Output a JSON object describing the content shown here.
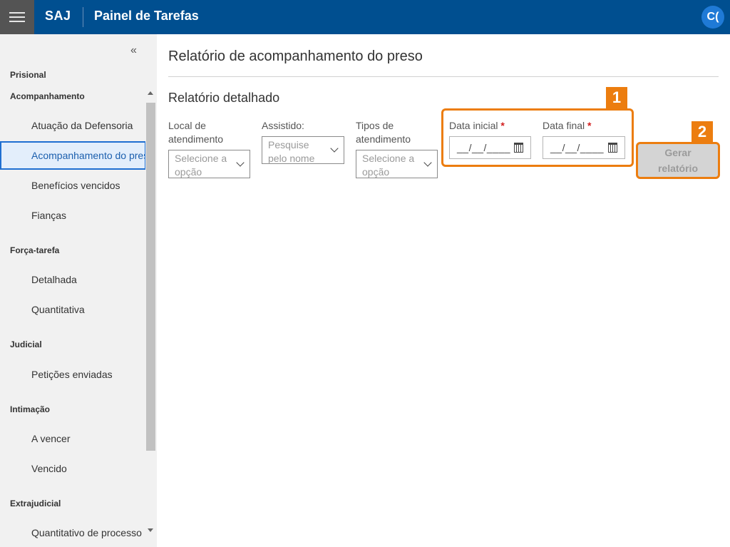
{
  "header": {
    "brand": "SAJ",
    "title": "Painel de Tarefas",
    "avatar": "C("
  },
  "sidebar": {
    "collapse_symbol": "«",
    "sections": [
      {
        "label": "Prisional"
      },
      {
        "label": "Acompanhamento"
      },
      {
        "label": "Força-tarefa"
      },
      {
        "label": "Judicial"
      },
      {
        "label": "Intimação"
      },
      {
        "label": "Extrajudicial"
      }
    ],
    "items": [
      {
        "label": "Atuação da Defensoria"
      },
      {
        "label": "Acompanhamento do preso"
      },
      {
        "label": "Benefícios vencidos"
      },
      {
        "label": "Fianças"
      },
      {
        "label": "Detalhada"
      },
      {
        "label": "Quantitativa"
      },
      {
        "label": "Petições enviadas"
      },
      {
        "label": "A vencer"
      },
      {
        "label": "Vencido"
      },
      {
        "label": "Quantitativo de processo"
      }
    ]
  },
  "main": {
    "page_title": "Relatório de acompanhamento do preso",
    "subtitle": "Relatório detalhado",
    "filters": {
      "local_label_1": "Local de",
      "local_label_2": "atendimento",
      "local_placeholder_1": "Selecione a",
      "local_placeholder_2": "opção",
      "assistido_label": "Assistido:",
      "assistido_placeholder_1": "Pesquise",
      "assistido_placeholder_2": "pelo nome",
      "tipos_label_1": "Tipos de",
      "tipos_label_2": "atendimento",
      "tipos_placeholder_1": "Selecione a",
      "tipos_placeholder_2": "opção",
      "data_inicial_label": "Data inicial",
      "data_final_label": "Data final",
      "required_mark": "*",
      "date_mask": "__/__/____"
    },
    "generate_button_1": "Gerar",
    "generate_button_2": "relatório",
    "annotations": {
      "badge_1": "1",
      "badge_2": "2",
      "color": "#ec7d0f"
    }
  },
  "colors": {
    "topbar": "#004f90",
    "active_item_border": "#1f6fd1",
    "required": "#d21f1f"
  }
}
